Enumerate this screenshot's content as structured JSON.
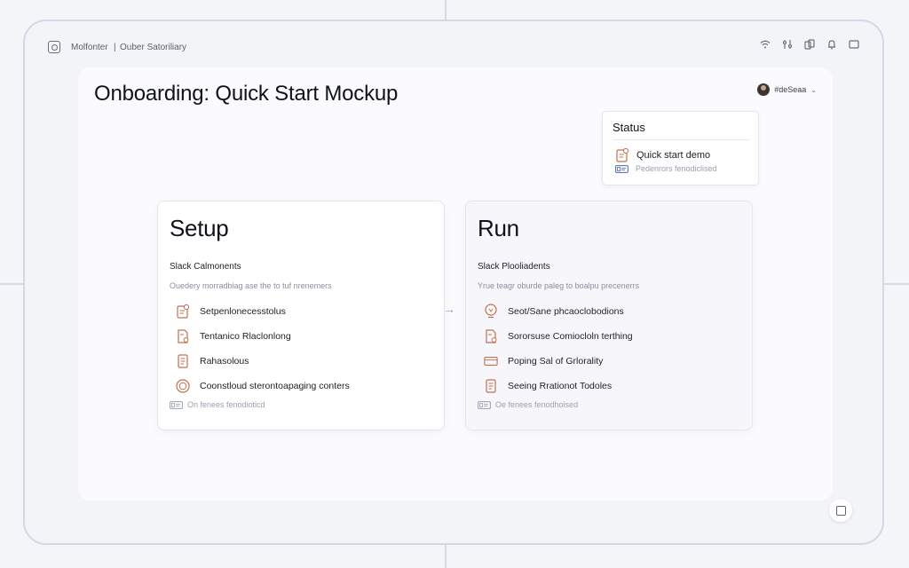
{
  "titlebar": {
    "crumb_app": "Molfonter",
    "crumb_separator": "|",
    "crumb_page": "Ouber Satoriliary",
    "icons": [
      "wifi-icon",
      "sliders-icon",
      "layers-icon",
      "bell-icon",
      "window-icon"
    ]
  },
  "page": {
    "title": "Onboarding: Quick Start Mockup"
  },
  "user_menu": {
    "name": "#deSeaa",
    "chevron": "⌄"
  },
  "status": {
    "title": "Status",
    "primary": "Quick start demo",
    "secondary": "Pedenrors fenodiclised"
  },
  "flow_arrow": "→",
  "cards": {
    "setup": {
      "title": "Setup",
      "subtitle": "Slack Calmonents",
      "description": "Ouedery morradbiag ase the to tuf nrenemers",
      "items": [
        "Setpenlonecesstolus",
        "Tentanico Rlaclonlong",
        "Rahasolous",
        "Coonstloud sterontoapaging conters"
      ],
      "footer": "On fenees fenodioticd"
    },
    "run": {
      "title": "Run",
      "subtitle": "Slack Plooliadents",
      "description": "Yrue teagr oburde paleg to boalpu precenerrs",
      "items": [
        "Seot/Sane phcaoclobodions",
        "Sororsuse Comiocloln terthing",
        "Poping Sal of Grlorality",
        "Seeing Rrationot Todoles"
      ],
      "footer": "Oe fenees fenodhoised"
    }
  },
  "colors": {
    "accent_icon": "#c0704f",
    "accent_blue": "#4b6ab0",
    "grid": "#d5daea"
  }
}
